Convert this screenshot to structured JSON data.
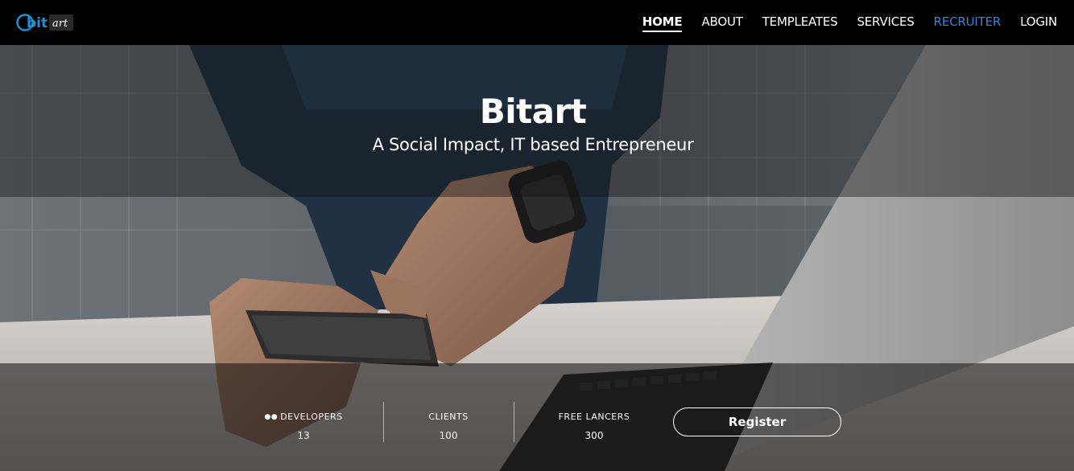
{
  "header": {
    "logo": {
      "icon": "bit-art-logo",
      "text_primary": "bit",
      "text_secondary": "art",
      "colors": {
        "primary": "#1e90d6",
        "secondary_bg": "#2a2a2a"
      }
    },
    "nav": [
      {
        "label": "HOME",
        "active": true
      },
      {
        "label": "ABOUT",
        "active": false
      },
      {
        "label": "TEMPLEATES",
        "active": false
      },
      {
        "label": "SERVICES",
        "active": false
      },
      {
        "label": "RECRUITER",
        "active": false,
        "color": "#3b7fe0"
      },
      {
        "label": "LOGIN",
        "active": false
      }
    ]
  },
  "hero": {
    "title": "Bitart",
    "subtitle": "A Social Impact, IT based Entrepreneur",
    "background_image": "person using smartphone at desk with laptop"
  },
  "stats": [
    {
      "label": "DEVELOPERS",
      "value": "13",
      "icon": "group-icon"
    },
    {
      "label": "CLIENTS",
      "value": "100"
    },
    {
      "label": "FREE LANCERS",
      "value": "300"
    }
  ],
  "cta": {
    "register_label": "Register"
  }
}
